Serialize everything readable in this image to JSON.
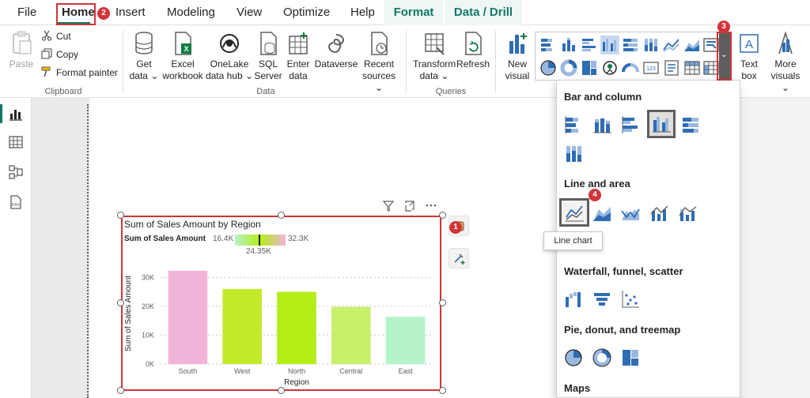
{
  "menubar": {
    "file": "File",
    "home": "Home",
    "insert": "Insert",
    "modeling": "Modeling",
    "view": "View",
    "optimize": "Optimize",
    "help": "Help",
    "format": "Format",
    "data_drill": "Data / Drill"
  },
  "ribbon": {
    "paste": "Paste",
    "cut": "Cut",
    "copy": "Copy",
    "format_painter": "Format painter",
    "clipboard_label": "Clipboard",
    "get_data_1": "Get",
    "get_data_2": "data",
    "excel_1": "Excel",
    "excel_2": "workbook",
    "onelake_1": "OneLake",
    "onelake_2": "data hub",
    "sql_1": "SQL",
    "sql_2": "Server",
    "enter_1": "Enter",
    "enter_2": "data",
    "dataverse": "Dataverse",
    "recent_1": "Recent",
    "recent_2": "sources",
    "data_label": "Data",
    "transform_1": "Transform",
    "transform_2": "data",
    "refresh": "Refresh",
    "queries_label": "Queries",
    "new_visual_1": "New",
    "new_visual_2": "visual",
    "text_box_1": "Text",
    "text_box_2": "box",
    "more_visuals_1": "More",
    "more_visuals_2": "visuals"
  },
  "visual": {
    "title": "Sum of Sales Amount by Region",
    "legend_label": "Sum of Sales Amount",
    "legend_min": "16.4K",
    "legend_max": "32.3K",
    "legend_avg": "24.35K"
  },
  "chart_data": {
    "type": "bar",
    "title": "Sum of Sales Amount by Region",
    "xlabel": "Region",
    "ylabel": "Sum of Sales Amount",
    "categories": [
      "South",
      "West",
      "North",
      "Central",
      "East"
    ],
    "values": [
      32300,
      26000,
      25000,
      19800,
      16400
    ],
    "colors": [
      "#f2b3d8",
      "#c2ea2a",
      "#b3ee14",
      "#c9f06a",
      "#b5f3c8"
    ],
    "yticks": [
      "0K",
      "10K",
      "20K",
      "30K"
    ],
    "ylim": [
      0,
      35000
    ],
    "grid": true
  },
  "panel": {
    "bar_column": "Bar and column",
    "line_area": "Line and area",
    "waterfall": "Waterfall, funnel, scatter",
    "pie": "Pie, donut, and treemap",
    "maps": "Maps",
    "tooltip": "Line chart"
  },
  "badges": {
    "b1": "1",
    "b2": "2",
    "b3": "3",
    "b4": "4"
  },
  "colors": {
    "accent": "#117865",
    "highlight": "#d13438",
    "visual_icon_blue": "#2f6db3"
  }
}
